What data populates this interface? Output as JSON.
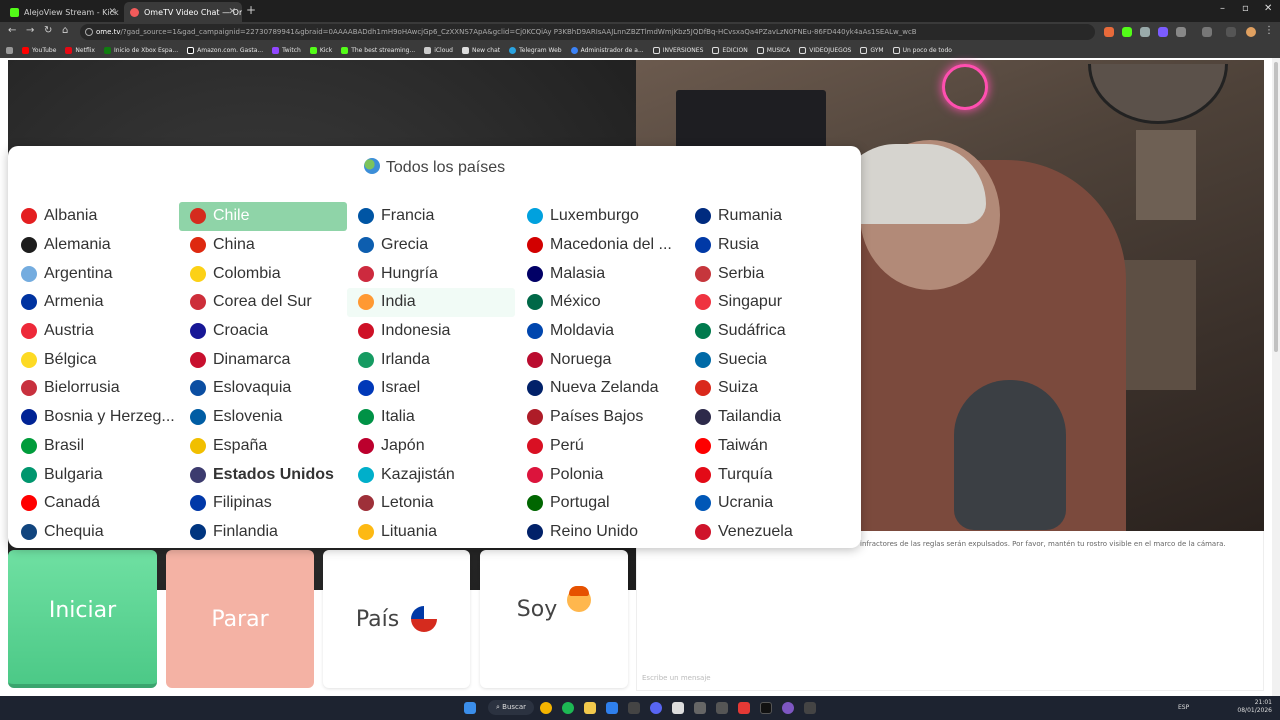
{
  "browser": {
    "tabs": [
      {
        "title": "AlejoView Stream - Kick Dashb",
        "active": false
      },
      {
        "title": "OmeTV Video Chat — Ome",
        "active": true
      }
    ],
    "url_host": "ome.tv",
    "url_rest": "/?gad_source=1&gad_campaignid=22730789941&gbraid=0AAAABADdh1mH9oHAwcjGp6_CzXXNS7ApA&gclid=Cj0KCQiAy P3KBhD9ARIsAAJLnnZBZTlmdWmjKbz5JQDfBq-HCvsxaQa4PZavLzN0FNEu-86FD440yk4aAs1SEALw_wcB",
    "bookmarks": [
      "YouTube",
      "Netflix",
      "Inicio de Xbox Espa...",
      "Amazon.com. Gasta...",
      "Twitch",
      "Kick",
      "The best streaming...",
      "iCloud",
      "New chat",
      "Telegram Web",
      "Administrador de a...",
      "INVERSIONES",
      "EDICION",
      "MUSICA",
      "VIDEOJUEGOS",
      "GYM",
      "Un poco de todo"
    ]
  },
  "country_modal": {
    "title": "Todos los países",
    "selected": "Chile",
    "columns": [
      [
        {
          "name": "Albania",
          "flag": "#e41e20"
        },
        {
          "name": "Alemania",
          "flag": "#1d1d1d"
        },
        {
          "name": "Argentina",
          "flag": "#74acdf"
        },
        {
          "name": "Armenia",
          "flag": "#0033a0"
        },
        {
          "name": "Austria",
          "flag": "#ed2939"
        },
        {
          "name": "Bélgica",
          "flag": "#fdda24"
        },
        {
          "name": "Bielorrusia",
          "flag": "#c8313e"
        },
        {
          "name": "Bosnia y Herzeg...",
          "flag": "#002395"
        },
        {
          "name": "Brasil",
          "flag": "#009c3b"
        },
        {
          "name": "Bulgaria",
          "flag": "#00966e"
        },
        {
          "name": "Canadá",
          "flag": "#ff0000"
        },
        {
          "name": "Chequia",
          "flag": "#11457e"
        }
      ],
      [
        {
          "name": "Chile",
          "flag": "#d52b1e"
        },
        {
          "name": "China",
          "flag": "#de2910"
        },
        {
          "name": "Colombia",
          "flag": "#fcd116"
        },
        {
          "name": "Corea del Sur",
          "flag": "#cd2e3a"
        },
        {
          "name": "Croacia",
          "flag": "#171796"
        },
        {
          "name": "Dinamarca",
          "flag": "#c8102e"
        },
        {
          "name": "Eslovaquia",
          "flag": "#0b4ea2"
        },
        {
          "name": "Eslovenia",
          "flag": "#005da4"
        },
        {
          "name": "España",
          "flag": "#f1bf00"
        },
        {
          "name": "Estados Unidos",
          "flag": "#3c3b6e",
          "bold": true
        },
        {
          "name": "Filipinas",
          "flag": "#0038a8"
        },
        {
          "name": "Finlandia",
          "flag": "#003580"
        }
      ],
      [
        {
          "name": "Francia",
          "flag": "#0055a4"
        },
        {
          "name": "Grecia",
          "flag": "#0d5eaf"
        },
        {
          "name": "Hungría",
          "flag": "#cd2a3e"
        },
        {
          "name": "India",
          "flag": "#ff9933",
          "hover": true
        },
        {
          "name": "Indonesia",
          "flag": "#ce1126"
        },
        {
          "name": "Irlanda",
          "flag": "#169b62"
        },
        {
          "name": "Israel",
          "flag": "#0038b8"
        },
        {
          "name": "Italia",
          "flag": "#009246"
        },
        {
          "name": "Japón",
          "flag": "#bc002d"
        },
        {
          "name": "Kazajistán",
          "flag": "#00afca"
        },
        {
          "name": "Letonia",
          "flag": "#9e3039"
        },
        {
          "name": "Lituania",
          "flag": "#fdb913"
        }
      ],
      [
        {
          "name": "Luxemburgo",
          "flag": "#00a1de"
        },
        {
          "name": "Macedonia del ...",
          "flag": "#d20000"
        },
        {
          "name": "Malasia",
          "flag": "#010066"
        },
        {
          "name": "México",
          "flag": "#006847"
        },
        {
          "name": "Moldavia",
          "flag": "#0046ae"
        },
        {
          "name": "Noruega",
          "flag": "#ba0c2f"
        },
        {
          "name": "Nueva Zelanda",
          "flag": "#012169"
        },
        {
          "name": "Países Bajos",
          "flag": "#ae1c28"
        },
        {
          "name": "Perú",
          "flag": "#d91023"
        },
        {
          "name": "Polonia",
          "flag": "#dc143c"
        },
        {
          "name": "Portugal",
          "flag": "#006600"
        },
        {
          "name": "Reino Unido",
          "flag": "#012169"
        }
      ],
      [
        {
          "name": "Rumania",
          "flag": "#002b7f"
        },
        {
          "name": "Rusia",
          "flag": "#0039a6"
        },
        {
          "name": "Serbia",
          "flag": "#c6363c"
        },
        {
          "name": "Singapur",
          "flag": "#ef3340"
        },
        {
          "name": "Sudáfrica",
          "flag": "#007a4d"
        },
        {
          "name": "Suecia",
          "flag": "#006aa7"
        },
        {
          "name": "Suiza",
          "flag": "#da291c"
        },
        {
          "name": "Tailandia",
          "flag": "#2d2a4a"
        },
        {
          "name": "Taiwán",
          "flag": "#fe0000"
        },
        {
          "name": "Turquía",
          "flag": "#e30a17"
        },
        {
          "name": "Ucrania",
          "flag": "#0057b7"
        },
        {
          "name": "Venezuela",
          "flag": "#cf142b"
        }
      ]
    ]
  },
  "controls": {
    "start": "Iniciar",
    "stop": "Parar",
    "country": "País",
    "soy": "Soy"
  },
  "chat": {
    "rules_notice": "infractores de las reglas serán expulsados. Por favor, mantén tu rostro visible en el marco de la cámara.",
    "input_placeholder": "Escribe un mensaje"
  },
  "taskbar": {
    "search": "Buscar",
    "lang": "ESP",
    "time": "21:01",
    "date": "08/01/2026"
  }
}
